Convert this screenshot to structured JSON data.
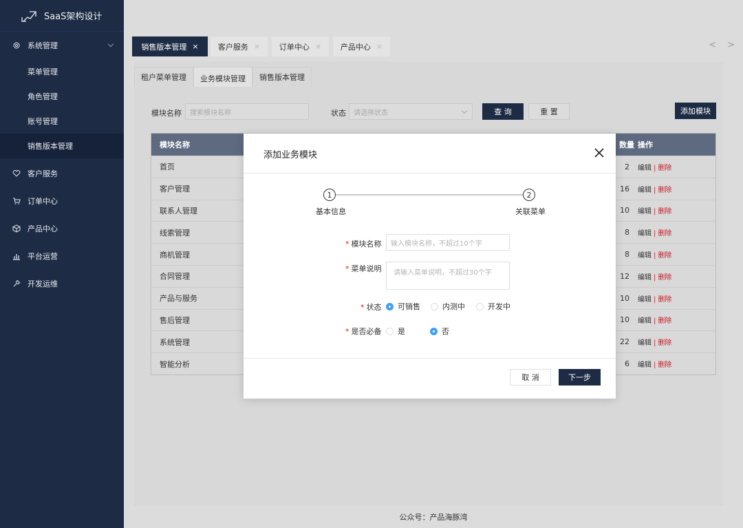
{
  "sidebar": {
    "logo_text": "SaaS架构设计",
    "groups": [
      {
        "label": "系统管理",
        "icon": "gear-icon"
      },
      {
        "label": "客户服务",
        "icon": "heart-icon"
      },
      {
        "label": "订单中心",
        "icon": "cart-icon"
      },
      {
        "label": "产品中心",
        "icon": "box-icon"
      },
      {
        "label": "平台运营",
        "icon": "chart-icon"
      },
      {
        "label": "开发运维",
        "icon": "wrench-icon"
      }
    ],
    "sub_items": [
      "菜单管理",
      "角色管理",
      "账号管理",
      "销售版本管理"
    ]
  },
  "tabs": [
    {
      "label": "销售版本管理",
      "close": "×"
    },
    {
      "label": "客户服务",
      "close": "×"
    },
    {
      "label": "订单中心",
      "close": "×"
    },
    {
      "label": "产品中心",
      "close": "×"
    }
  ],
  "tab_arrows": "< >",
  "subtabs": [
    "租户菜单管理",
    "业务模块管理",
    "销售版本管理"
  ],
  "filter": {
    "name_label": "模块名称",
    "name_placeholder": "搜索模块名称",
    "status_label": "状态",
    "status_placeholder": "请选择状态",
    "search_button": "查 询",
    "reset_button": "重 置",
    "add_button": "添加模块"
  },
  "table": {
    "headers": {
      "name": "模块名称",
      "count": "数量",
      "ops": "操作"
    },
    "op_edit": "编辑",
    "op_sep": "|",
    "op_delete": "删除",
    "rows": [
      {
        "name": "首页",
        "count": "2"
      },
      {
        "name": "客户管理",
        "count": "16"
      },
      {
        "name": "联系人管理",
        "count": "10"
      },
      {
        "name": "线索管理",
        "count": "8"
      },
      {
        "name": "商机管理",
        "count": "8"
      },
      {
        "name": "合同管理",
        "count": "12"
      },
      {
        "name": "产品与服务",
        "count": "10"
      },
      {
        "name": "售后管理",
        "count": "10"
      },
      {
        "name": "系统管理",
        "count": "22"
      },
      {
        "name": "智能分析",
        "count": "6"
      }
    ]
  },
  "footer": "公众号：产品海豚湾",
  "modal": {
    "title": "添加业务模块",
    "steps": [
      {
        "num": "1",
        "label": "基本信息"
      },
      {
        "num": "2",
        "label": "关联菜单"
      }
    ],
    "fields": {
      "name_label": "模块名称",
      "name_placeholder": "输入模块名称，不超过10个字",
      "desc_label": "菜单说明",
      "desc_placeholder": "请输入菜单说明，不超过30个字",
      "status_label": "状态",
      "status_options": [
        "可销售",
        "内测中",
        "开发中"
      ],
      "status_selected": "可销售",
      "required_label": "是否必备",
      "required_options": [
        "是",
        "否"
      ],
      "required_selected": "否"
    },
    "cancel_button": "取 消",
    "next_button": "下一步"
  },
  "colors": {
    "sidebar_bg": "#1d2b44",
    "accent_radio": "#409eff",
    "delete_red": "#c0232b"
  }
}
